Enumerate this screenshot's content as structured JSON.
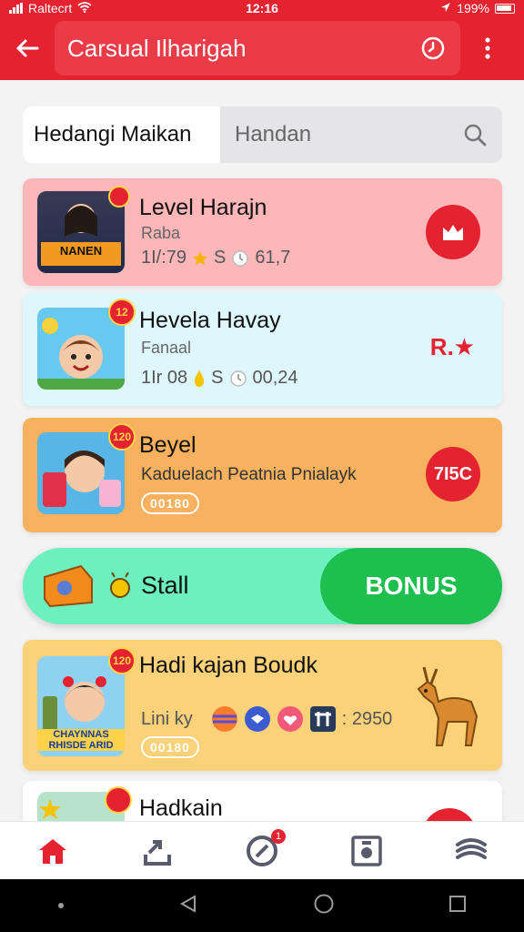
{
  "status_bar": {
    "carrier": "Raltecrt",
    "time": "12:16",
    "battery": "199%"
  },
  "app_bar": {
    "title": "Carsual Ilharigah"
  },
  "search": {
    "tab_label": "Hedangi Maikan",
    "placeholder": "Handan"
  },
  "cards": [
    {
      "title": "Level Harajn",
      "subtitle": "Raba",
      "stat1": "1I/:79",
      "stat2": "S",
      "stat3": "61,7",
      "badge": "",
      "thumb_text": "NANEN"
    },
    {
      "title": "Hevela Havay",
      "subtitle": "Fanaal",
      "stat1": "1Ir 08",
      "stat2": "S",
      "stat3": "00,24",
      "badge": "12",
      "right_label": "R.★"
    },
    {
      "title": "Beyel",
      "subtitle": "Kaduelach Peatnia Pnialayk",
      "pill": "00180",
      "badge": "120",
      "right_label": "7I5C"
    },
    {
      "title": "Hadi kajan Boudk",
      "subtitle": "Lini ky",
      "meta_value": ": 2950",
      "pill": "00180",
      "badge": "120",
      "thumb_text": "CHAYNNAS RHISDE ARID"
    },
    {
      "title": "Hadkain",
      "badge": ""
    }
  ],
  "bonus": {
    "title": "Stall",
    "button_label": "BONUS"
  },
  "nav": {
    "notification_count": "1"
  },
  "colors": {
    "primary": "#e52330",
    "bonus_green": "#1fbf4f",
    "mint": "#6cf0bd"
  }
}
